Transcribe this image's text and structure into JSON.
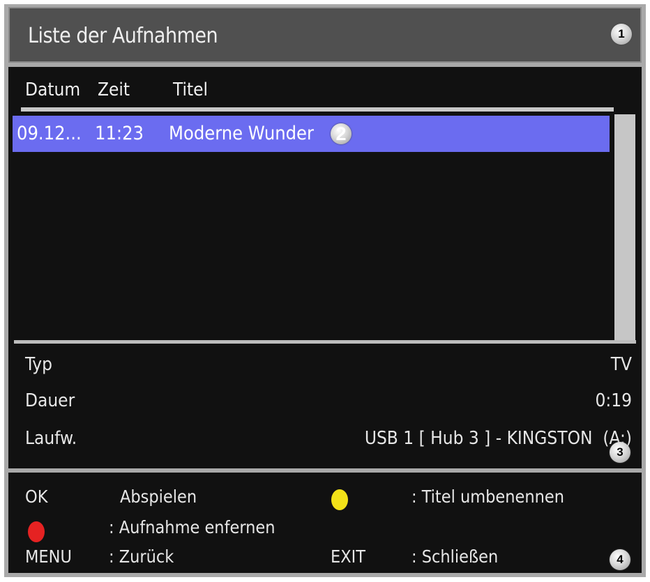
{
  "header": {
    "title": "Liste der Aufnahmen",
    "badge": "1"
  },
  "columns": {
    "date": "Datum",
    "time": "Zeit",
    "title": "Titel"
  },
  "recordings": [
    {
      "date": "09.12...",
      "time": "11:23",
      "title": "Moderne Wunder",
      "badge": "2"
    }
  ],
  "info": {
    "type_label": "Typ",
    "type_value": "TV",
    "duration_label": "Dauer",
    "duration_value": "0:19",
    "drive_label": "Laufw.",
    "drive_value": "USB 1 [ Hub 3 ] - KINGSTON  (A:)",
    "badge": "3"
  },
  "footer": {
    "ok_key": "OK",
    "ok_action": "Abspielen",
    "yellow_action": ": Titel umbenennen",
    "red_action": ": Aufnahme enfernen",
    "menu_key": "MENU",
    "menu_action": ": Zurück",
    "exit_key": "EXIT",
    "exit_action": ": Schließen",
    "badge": "4",
    "yellow_color": "#f2e218",
    "red_color": "#e52222"
  },
  "colors": {
    "selected_row": "#6b6cf0",
    "panel": "#111111",
    "titlebar": "#505050"
  }
}
